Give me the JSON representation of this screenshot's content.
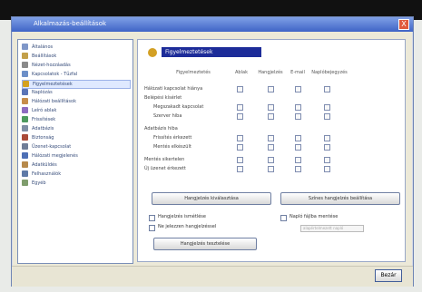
{
  "window": {
    "title": "Alkalmazás-beállítások",
    "close_label": "X"
  },
  "nav": [
    "Általános",
    "Beállítások",
    "Nézet-hozzáadás",
    "Kapcsolatok - Tűzfal",
    "Figyelmeztetések",
    "Naplózás",
    "Hálózati beállítások",
    "Leíró ablak",
    "Frissítések",
    "Adatbázis",
    "Biztonság",
    "Üzenet-kapcsolat",
    "Hálózati megjelenés",
    "Adatküldés",
    "Felhasználók",
    "Egyéb"
  ],
  "section_title": "Figyelmeztetések",
  "columns": [
    "Figyelmeztetés",
    "Ablak",
    "Hangjelzés",
    "E-mail",
    "Naplóbejegyzés"
  ],
  "rows": [
    "Hálózati kapcsolat hiánya",
    "Belépési kísérlet",
    "Megszakadt kapcsolat",
    "Szerver hiba",
    "Adatbázis hiba",
    "Frissítés érkezett",
    "Mentés elkészült",
    "Mentés sikertelen",
    "Új üzenet érkezett"
  ],
  "buttons": {
    "left": "Hangjelzés kiválasztása",
    "right": "Színes hangjelzés beállítása",
    "bottom": "Hangjelzés tesztelése",
    "ok": "Bezár"
  },
  "options": {
    "left1": "Hangjelzés ismétlése",
    "left2": "Ne jelezzen hangjelzéssel",
    "right": "Napló fájlba mentése",
    "placeholder": "alapértelmezett napló"
  }
}
